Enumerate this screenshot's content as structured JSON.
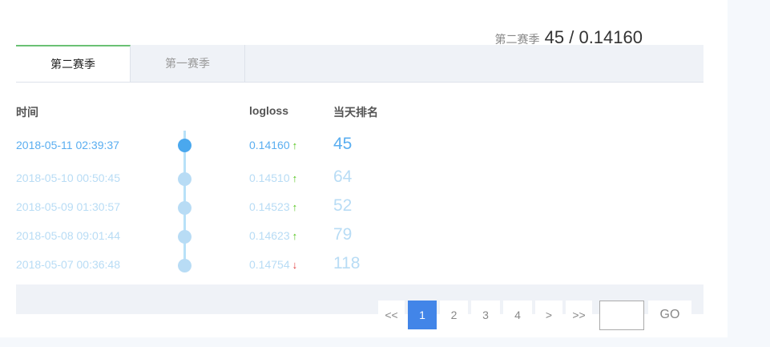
{
  "summary": {
    "label": "第二赛季",
    "value": "45 / 0.14160"
  },
  "tabs": [
    {
      "label": "第二赛季",
      "active": true
    },
    {
      "label": "第一赛季",
      "active": false
    }
  ],
  "headers": {
    "time": "时间",
    "logloss": "logloss",
    "rank": "当天排名"
  },
  "rows": [
    {
      "time": "2018-05-11 02:39:37",
      "logloss": "0.14160",
      "trend": "↑",
      "rank": "45"
    },
    {
      "time": "2018-05-10 00:50:45",
      "logloss": "0.14510",
      "trend": "↑",
      "rank": "64"
    },
    {
      "time": "2018-05-09 01:30:57",
      "logloss": "0.14523",
      "trend": "↑",
      "rank": "52"
    },
    {
      "time": "2018-05-08 09:01:44",
      "logloss": "0.14623",
      "trend": "↑",
      "rank": "79"
    },
    {
      "time": "2018-05-07 00:36:48",
      "logloss": "0.14754",
      "trend": "↓",
      "rank": "118"
    }
  ],
  "pagination": {
    "first": "<<",
    "pages": [
      "1",
      "2",
      "3",
      "4"
    ],
    "next": ">",
    "last": ">>",
    "go": "GO",
    "current": "1",
    "input_value": ""
  },
  "colors": {
    "up": "#52c41a",
    "down": "#e03c3c",
    "accent": "#4285e8",
    "latest": "#5aaef0",
    "faded": "#b8dcf5"
  }
}
